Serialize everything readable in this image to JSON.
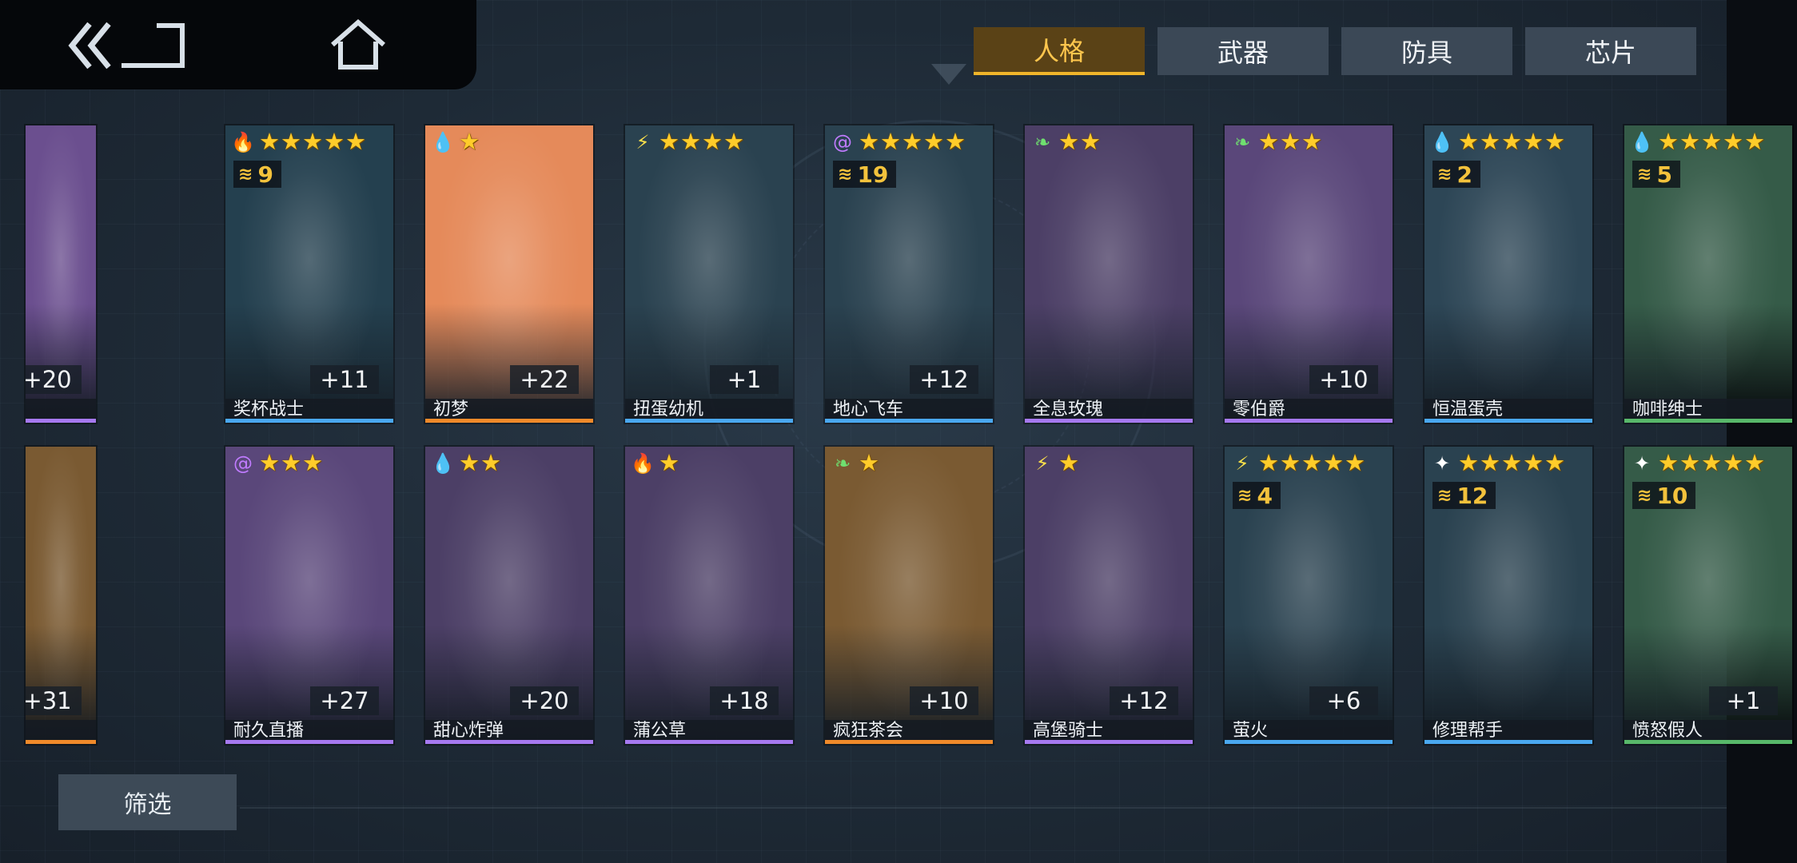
{
  "topbar": {
    "back_icon": "double-chevron-back-icon",
    "home_icon": "home-icon"
  },
  "tabs": [
    {
      "label": "人格",
      "active": true
    },
    {
      "label": "武器",
      "active": false
    },
    {
      "label": "防具",
      "active": false
    },
    {
      "label": "芯片",
      "active": false
    }
  ],
  "cards": [
    {
      "name": "",
      "stars": 0,
      "element": "",
      "stack": "",
      "level": "+20",
      "bg": "#6b4f8f",
      "border": "purple",
      "partial": true
    },
    {
      "name": "奖杯战士",
      "stars": 5,
      "element": "fire",
      "stack": "9",
      "level": "+11",
      "bg": "#24404f",
      "border": "blue"
    },
    {
      "name": "初梦",
      "stars": 1,
      "element": "water",
      "stack": "",
      "level": "+22",
      "bg": "#e58a5a",
      "border": "orange"
    },
    {
      "name": "扭蛋幼机",
      "stars": 4,
      "element": "thunder",
      "stack": "",
      "level": "+1",
      "bg": "#2a4250",
      "border": "blue"
    },
    {
      "name": "地心飞车",
      "stars": 5,
      "element": "spiral",
      "stack": "19",
      "level": "+12",
      "bg": "#2a4250",
      "border": "blue"
    },
    {
      "name": "全息玫瑰",
      "stars": 2,
      "element": "leaf",
      "stack": "",
      "level": "",
      "bg": "#4c3f66",
      "border": "purple"
    },
    {
      "name": "零伯爵",
      "stars": 3,
      "element": "leaf",
      "stack": "",
      "level": "+10",
      "bg": "#5a477a",
      "border": "purple"
    },
    {
      "name": "恒温蛋壳",
      "stars": 5,
      "element": "water",
      "stack": "2",
      "level": "",
      "bg": "#2d4656",
      "border": "blue"
    },
    {
      "name": "咖啡绅士",
      "stars": 5,
      "element": "water",
      "stack": "5",
      "level": "",
      "bg": "#355b48",
      "border": "green"
    },
    {
      "name": "",
      "stars": 0,
      "element": "",
      "stack": "",
      "level": "+31",
      "bg": "#7a5a32",
      "border": "orange",
      "partial": true
    },
    {
      "name": "耐久直播",
      "stars": 3,
      "element": "spiral",
      "stack": "",
      "level": "+27",
      "bg": "#5a477a",
      "border": "purple"
    },
    {
      "name": "甜心炸弹",
      "stars": 2,
      "element": "water",
      "stack": "",
      "level": "+20",
      "bg": "#4c3f66",
      "border": "purple"
    },
    {
      "name": "蒲公草",
      "stars": 1,
      "element": "fire",
      "stack": "",
      "level": "+18",
      "bg": "#4c3f66",
      "border": "purple"
    },
    {
      "name": "疯狂茶会",
      "stars": 1,
      "element": "leaf",
      "stack": "",
      "level": "+10",
      "bg": "#7a5a32",
      "border": "orange"
    },
    {
      "name": "高堡骑士",
      "stars": 1,
      "element": "thunder",
      "stack": "",
      "level": "+12",
      "bg": "#4c3f66",
      "border": "purple"
    },
    {
      "name": "萤火",
      "stars": 5,
      "element": "thunder",
      "stack": "4",
      "level": "+6",
      "bg": "#2a4250",
      "border": "blue"
    },
    {
      "name": "修理帮手",
      "stars": 5,
      "element": "light",
      "stack": "12",
      "level": "",
      "bg": "#2a4250",
      "border": "blue"
    },
    {
      "name": "愤怒假人",
      "stars": 5,
      "element": "light",
      "stack": "10",
      "level": "+1",
      "bg": "#355b48",
      "border": "green"
    }
  ],
  "element_glyphs": {
    "fire": {
      "glyph": "🔥",
      "color": "#ff5a3a"
    },
    "water": {
      "glyph": "💧",
      "color": "#5ab8ff"
    },
    "thunder": {
      "glyph": "⚡",
      "color": "#ffe24a"
    },
    "spiral": {
      "glyph": "@",
      "color": "#c07bff"
    },
    "leaf": {
      "glyph": "❧",
      "color": "#6fe06f"
    },
    "light": {
      "glyph": "✦",
      "color": "#ffffff"
    }
  },
  "filter": {
    "label": "筛选"
  }
}
